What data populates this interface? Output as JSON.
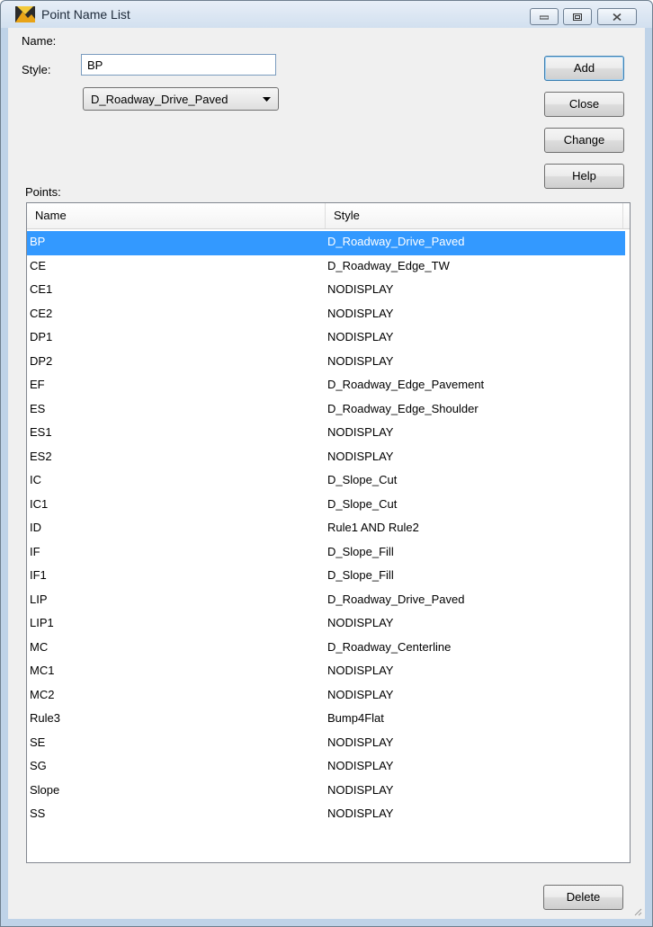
{
  "window": {
    "title": "Point Name List",
    "icon": "app-icon"
  },
  "form": {
    "name_label": "Name:",
    "name_value": "BP",
    "style_label": "Style:",
    "style_value": "D_Roadway_Drive_Paved",
    "points_label": "Points:"
  },
  "buttons": {
    "add": "Add",
    "close": "Close",
    "change": "Change",
    "help": "Help",
    "delete": "Delete"
  },
  "table": {
    "columns": [
      "Name",
      "Style"
    ],
    "selected_index": 0,
    "rows": [
      {
        "name": "BP",
        "style": "D_Roadway_Drive_Paved"
      },
      {
        "name": "CE",
        "style": "D_Roadway_Edge_TW"
      },
      {
        "name": "CE1",
        "style": "NODISPLAY"
      },
      {
        "name": "CE2",
        "style": "NODISPLAY"
      },
      {
        "name": "DP1",
        "style": "NODISPLAY"
      },
      {
        "name": "DP2",
        "style": "NODISPLAY"
      },
      {
        "name": "EF",
        "style": "D_Roadway_Edge_Pavement"
      },
      {
        "name": "ES",
        "style": "D_Roadway_Edge_Shoulder"
      },
      {
        "name": "ES1",
        "style": "NODISPLAY"
      },
      {
        "name": "ES2",
        "style": "NODISPLAY"
      },
      {
        "name": "IC",
        "style": "D_Slope_Cut"
      },
      {
        "name": "IC1",
        "style": "D_Slope_Cut"
      },
      {
        "name": "ID",
        "style": "Rule1 AND Rule2"
      },
      {
        "name": "IF",
        "style": "D_Slope_Fill"
      },
      {
        "name": "IF1",
        "style": "D_Slope_Fill"
      },
      {
        "name": "LIP",
        "style": "D_Roadway_Drive_Paved"
      },
      {
        "name": "LIP1",
        "style": "NODISPLAY"
      },
      {
        "name": "MC",
        "style": "D_Roadway_Centerline"
      },
      {
        "name": "MC1",
        "style": "NODISPLAY"
      },
      {
        "name": "MC2",
        "style": "NODISPLAY"
      },
      {
        "name": "Rule3",
        "style": "Bump4Flat"
      },
      {
        "name": "SE",
        "style": "NODISPLAY"
      },
      {
        "name": "SG",
        "style": "NODISPLAY"
      },
      {
        "name": "Slope",
        "style": "NODISPLAY"
      },
      {
        "name": "SS",
        "style": "NODISPLAY"
      }
    ]
  },
  "colors": {
    "selection": "#3399ff",
    "default_button_border": "#3c7fb1"
  }
}
